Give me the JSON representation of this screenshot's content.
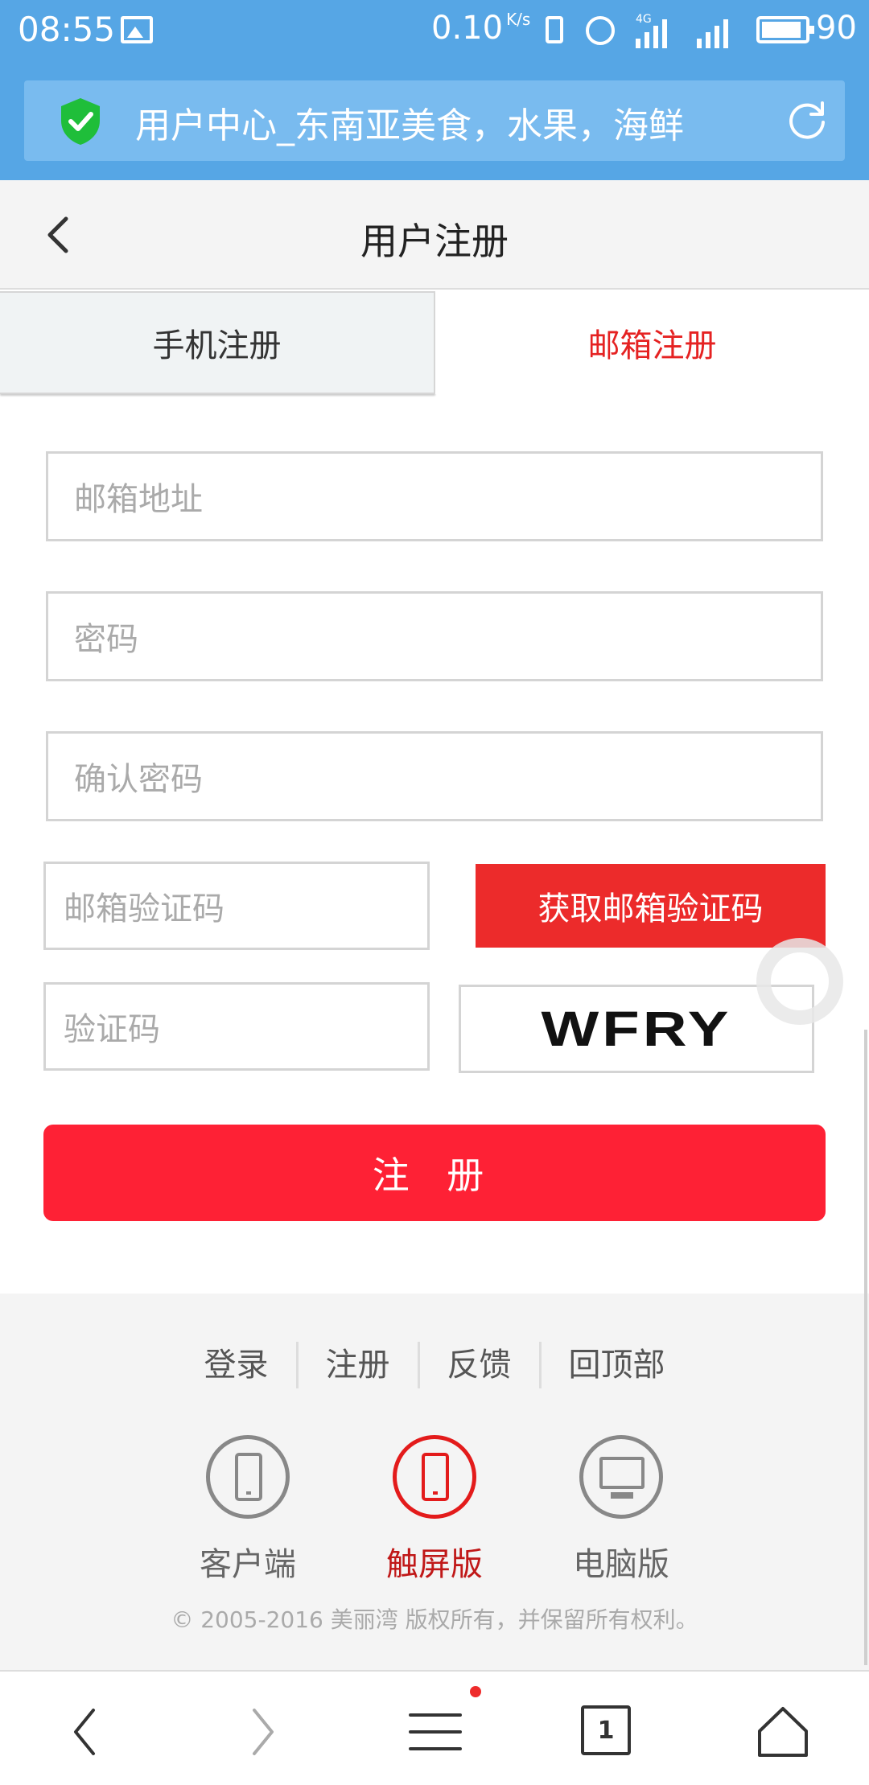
{
  "status_bar": {
    "time": "08:55",
    "net_speed": "0.10",
    "net_speed_unit": "K/s",
    "network_type": "4G",
    "battery": "90"
  },
  "browser": {
    "url_title": "用户中心_东南亚美食，水果，海鲜",
    "shield_color": "#1fbe3a"
  },
  "header": {
    "title": "用户注册"
  },
  "tabs": [
    {
      "label": "手机注册",
      "active": false
    },
    {
      "label": "邮箱注册",
      "active": true
    }
  ],
  "form": {
    "email_placeholder": "邮箱地址",
    "password_placeholder": "密码",
    "confirm_placeholder": "确认密码",
    "email_code_placeholder": "邮箱验证码",
    "get_code_label": "获取邮箱验证码",
    "captcha_placeholder": "验证码",
    "captcha_text": "WFRY",
    "submit_label": "注 册"
  },
  "footer": {
    "links": [
      "登录",
      "注册",
      "反馈",
      "回顶部"
    ],
    "apps": [
      {
        "label": "客户端",
        "icon": "phone-outline-icon",
        "active": false
      },
      {
        "label": "触屏版",
        "icon": "phone-outline-icon",
        "active": true
      },
      {
        "label": "电脑版",
        "icon": "monitor-icon",
        "active": false
      }
    ],
    "copyright": "© 2005-2016 美丽湾 版权所有，并保留所有权利。"
  },
  "bottom_nav": {
    "tab_count": "1"
  },
  "colors": {
    "topbar": "#56a6e5",
    "accent_red": "#fe2135",
    "tab_active_text": "#e52222"
  }
}
